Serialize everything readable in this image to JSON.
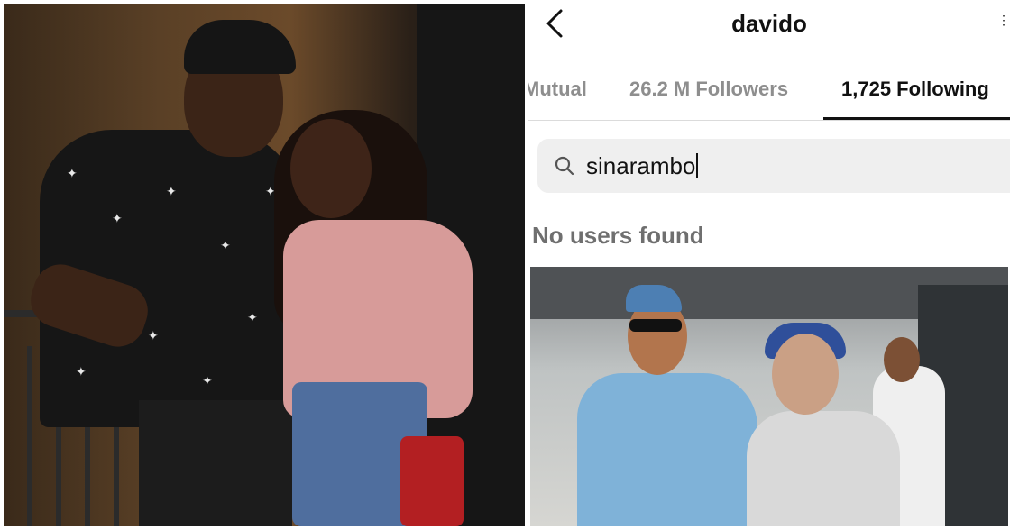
{
  "profile": {
    "username": "davido"
  },
  "tabs": [
    {
      "label": "Mutual",
      "active": false
    },
    {
      "label": "26.2 M Followers",
      "active": false
    },
    {
      "label": "1,725 Following",
      "active": true
    }
  ],
  "search": {
    "value": "sinarambo",
    "icon": "search-icon"
  },
  "results": {
    "empty_message": "No users found"
  },
  "icons": {
    "back": "chevron-left-icon"
  },
  "colors": {
    "text_primary": "#111111",
    "text_secondary": "#8e8e8e",
    "search_bg": "#efefef"
  }
}
